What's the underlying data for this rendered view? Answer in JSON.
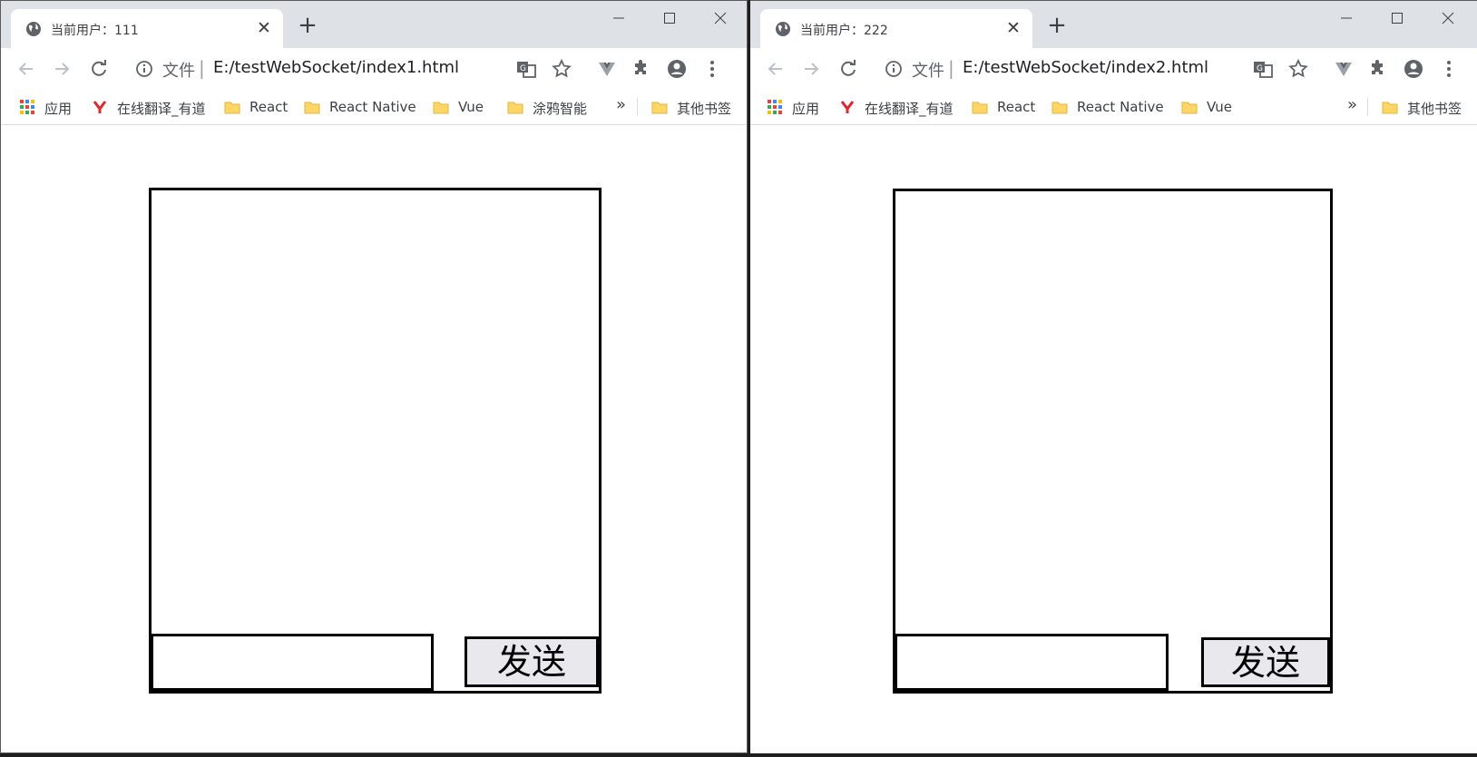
{
  "colors": {
    "tabstrip": "#dee1e6",
    "icon_gray": "#5f6368",
    "bookmark_folder": "#fdd663",
    "youdao_red": "#e4262b"
  },
  "windows": [
    {
      "tab_title": "当前用户：111",
      "omnibox": {
        "file_label": "文件",
        "separator": "|",
        "url": "E:/testWebSocket/index1.html"
      },
      "bookmarks": [
        {
          "icon": "apps-grid-icon",
          "label": "应用"
        },
        {
          "icon": "youdao-icon",
          "label": "在线翻译_有道"
        },
        {
          "icon": "folder-icon",
          "label": "React"
        },
        {
          "icon": "folder-icon",
          "label": "React Native"
        },
        {
          "icon": "folder-icon",
          "label": "Vue"
        },
        {
          "icon": "folder-icon",
          "label": "涂鸦智能"
        }
      ],
      "more_bookmarks": "»",
      "other_bookmarks": "其他书签",
      "chat": {
        "send_label": "发送",
        "input_value": ""
      }
    },
    {
      "tab_title": "当前用户：222",
      "omnibox": {
        "file_label": "文件",
        "separator": "|",
        "url": "E:/testWebSocket/index2.html"
      },
      "bookmarks": [
        {
          "icon": "apps-grid-icon",
          "label": "应用"
        },
        {
          "icon": "youdao-icon",
          "label": "在线翻译_有道"
        },
        {
          "icon": "folder-icon",
          "label": "React"
        },
        {
          "icon": "folder-icon",
          "label": "React Native"
        },
        {
          "icon": "folder-icon",
          "label": "Vue"
        }
      ],
      "more_bookmarks": "»",
      "other_bookmarks": "其他书签",
      "chat": {
        "send_label": "发送",
        "input_value": ""
      }
    }
  ]
}
